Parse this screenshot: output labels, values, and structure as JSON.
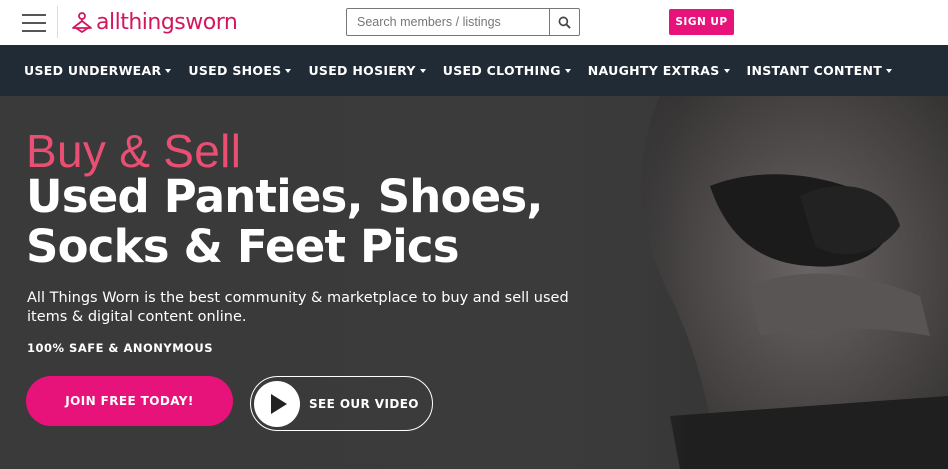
{
  "header": {
    "logo": {
      "prefix": "allthings",
      "suffix": "worn",
      "brand_color": "#d3175f"
    },
    "search": {
      "placeholder": "Search members / listings",
      "value": ""
    },
    "signup_label": "SIGN UP",
    "accent": "#e8137a"
  },
  "nav": {
    "items": [
      {
        "label": "USED UNDERWEAR"
      },
      {
        "label": "USED SHOES"
      },
      {
        "label": "USED HOSIERY"
      },
      {
        "label": "USED CLOTHING"
      },
      {
        "label": "NAUGHTY EXTRAS"
      },
      {
        "label": "INSTANT CONTENT"
      }
    ],
    "background": "#212b36"
  },
  "hero": {
    "kicker": "Buy & Sell",
    "headline_line1": "Used Panties, Shoes,",
    "headline_line2": "Socks & Feet Pics",
    "description": "All Things Worn is the best community & marketplace to buy and sell used items & digital content online.",
    "safe_note": "100% SAFE & ANONYMOUS",
    "join_label": "JOIN FREE TODAY!",
    "video_label": "SEE OUR VIDEO",
    "kicker_color": "#ea4f73"
  },
  "icons": {
    "menu": "hamburger-icon",
    "logo": "hanger-icon",
    "search": "search-icon",
    "play": "play-icon"
  }
}
